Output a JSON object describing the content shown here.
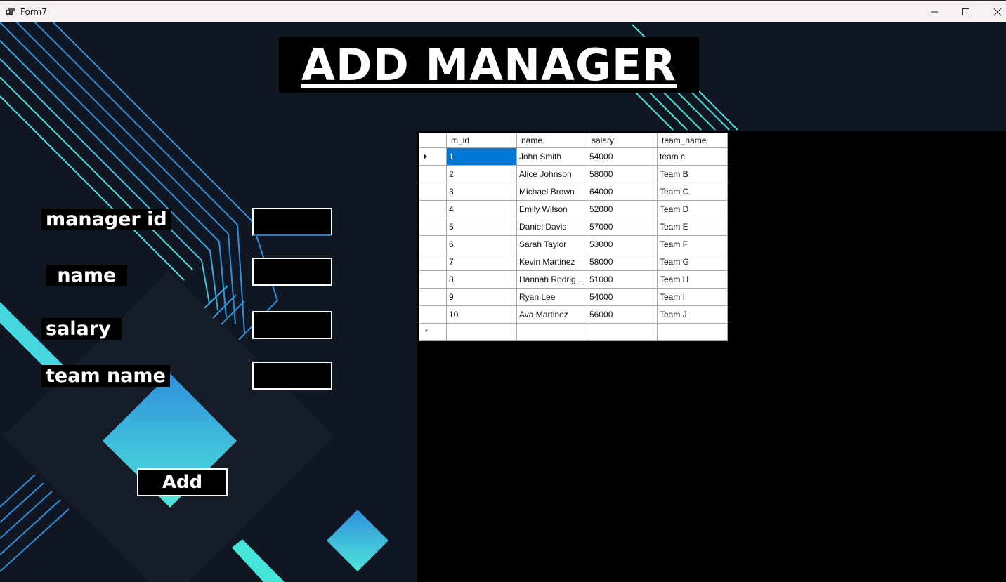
{
  "window": {
    "title": "Form7",
    "controls": [
      "minimize",
      "maximize",
      "close"
    ]
  },
  "heading": "ADD MANAGER",
  "form": {
    "labels": {
      "manager_id": "manager id",
      "name": " name ",
      "salary": "salary ",
      "team_name": "team name"
    },
    "values": {
      "manager_id": "",
      "name": "",
      "salary": "",
      "team_name": ""
    },
    "add_label": "Add"
  },
  "grid": {
    "columns": [
      "m_id",
      "name",
      "salary",
      "team_name"
    ],
    "rows": [
      [
        "1",
        "John Smith",
        "54000",
        "team c"
      ],
      [
        "2",
        "Alice Johnson",
        "58000",
        "Team B"
      ],
      [
        "3",
        "Michael Brown",
        "64000",
        "Team C"
      ],
      [
        "4",
        "Emily Wilson",
        "52000",
        "Team D"
      ],
      [
        "5",
        "Daniel Davis",
        "57000",
        "Team E"
      ],
      [
        "6",
        "Sarah Taylor",
        "53000",
        "Team F"
      ],
      [
        "7",
        "Kevin Martinez",
        "58000",
        "Team G"
      ],
      [
        "8",
        "Hannah Rodrig...",
        "51000",
        "Team H"
      ],
      [
        "9",
        "Ryan Lee",
        "54000",
        "Team I"
      ],
      [
        "10",
        "Ava Martinez",
        "56000",
        "Team J"
      ]
    ],
    "new_row_marker": "*",
    "selected": {
      "row": 1,
      "column": "m_id"
    }
  },
  "colors": {
    "background": "#111722",
    "accent_cyan": "#46e3d9",
    "accent_blue": "#2f8fdc",
    "selection": "#0078d7"
  },
  "icons": {
    "app": "form-app-icon",
    "row_current": "row-indicator-arrow-icon",
    "new_row": "new-row-asterisk-icon"
  }
}
